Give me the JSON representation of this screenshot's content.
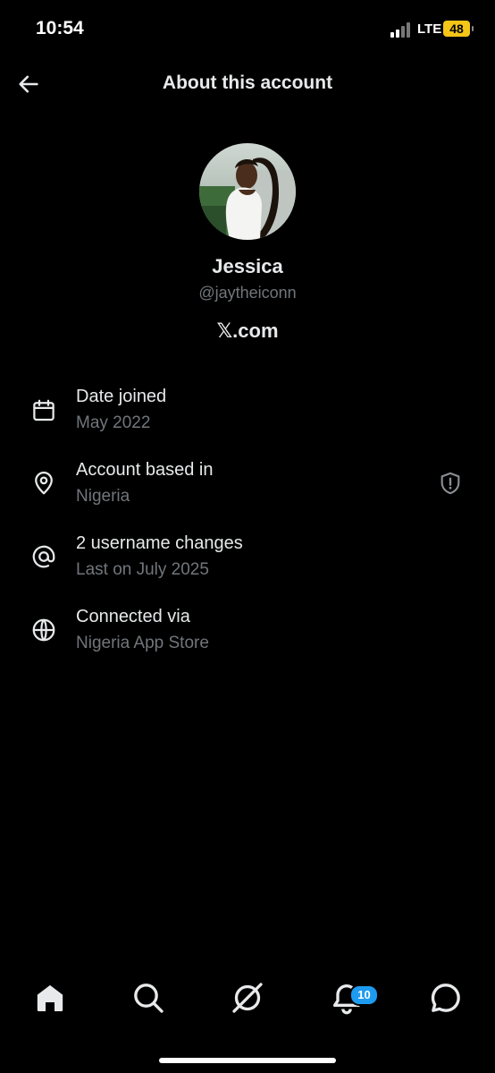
{
  "status_bar": {
    "time": "10:54",
    "network": "LTE",
    "battery": "48",
    "battery_color": "#f5c518"
  },
  "header": {
    "title": "About this account"
  },
  "profile": {
    "name": "Jessica",
    "handle": "@jaytheiconn",
    "site": "𝕏.com"
  },
  "info_rows": [
    {
      "icon": "calendar-icon",
      "label": "Date joined",
      "value": "May 2022"
    },
    {
      "icon": "location-pin-icon",
      "label": "Account based in",
      "value": "Nigeria"
    },
    {
      "icon": "at-sign-icon",
      "label": "2 username changes",
      "value": "Last on July 2025"
    },
    {
      "icon": "globe-icon",
      "label": "Connected via",
      "value": "Nigeria App Store"
    }
  ],
  "nav": {
    "items": [
      "home-icon",
      "search-icon",
      "grok-icon",
      "notifications-icon",
      "messages-icon"
    ],
    "notification_count": "10"
  },
  "colors": {
    "background": "#000000",
    "primary_text": "#e7e9ea",
    "secondary_text": "#71767b",
    "accent": "#1d9bf0"
  }
}
